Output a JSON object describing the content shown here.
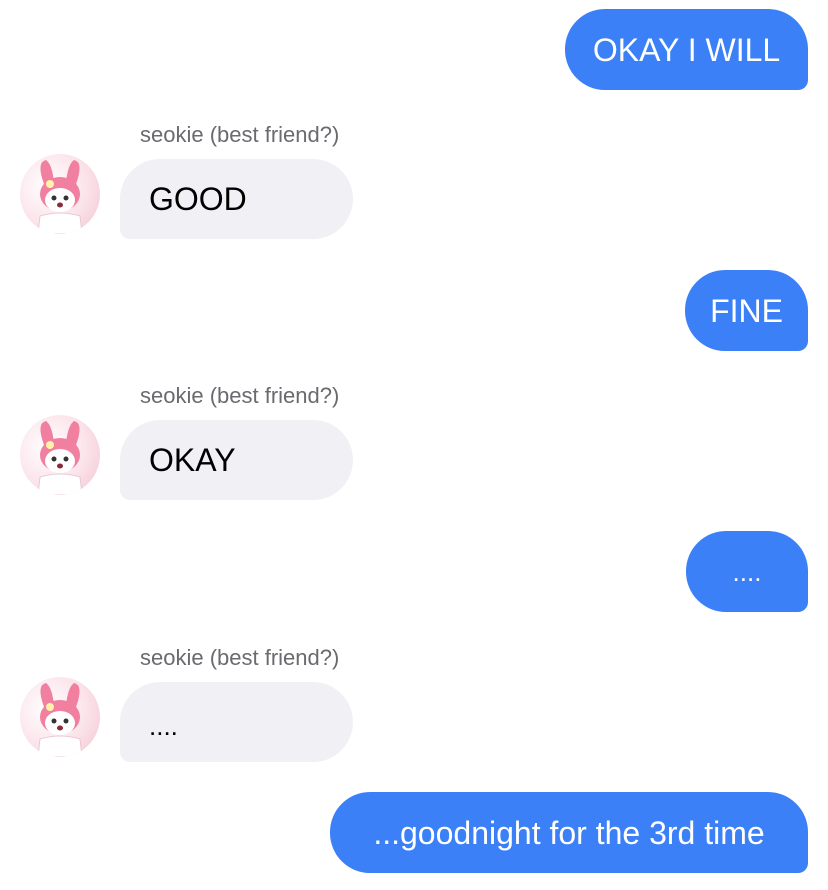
{
  "messages": [
    {
      "direction": "sent",
      "text": "OKAY I WILL"
    },
    {
      "direction": "received",
      "sender": "seokie (best friend?)",
      "text": "GOOD"
    },
    {
      "direction": "sent",
      "text": "FINE"
    },
    {
      "direction": "received",
      "sender": "seokie (best friend?)",
      "text": "OKAY"
    },
    {
      "direction": "sent",
      "text": "...."
    },
    {
      "direction": "received",
      "sender": "seokie (best friend?)",
      "text": "...."
    },
    {
      "direction": "sent",
      "text": "...goodnight for the 3rd time"
    }
  ],
  "avatar_icon": "my-melody-avatar-icon",
  "colors": {
    "sent_bubble": "#3b80f7",
    "received_bubble": "#f0f0f5",
    "sender_name": "#6a6a6f"
  }
}
